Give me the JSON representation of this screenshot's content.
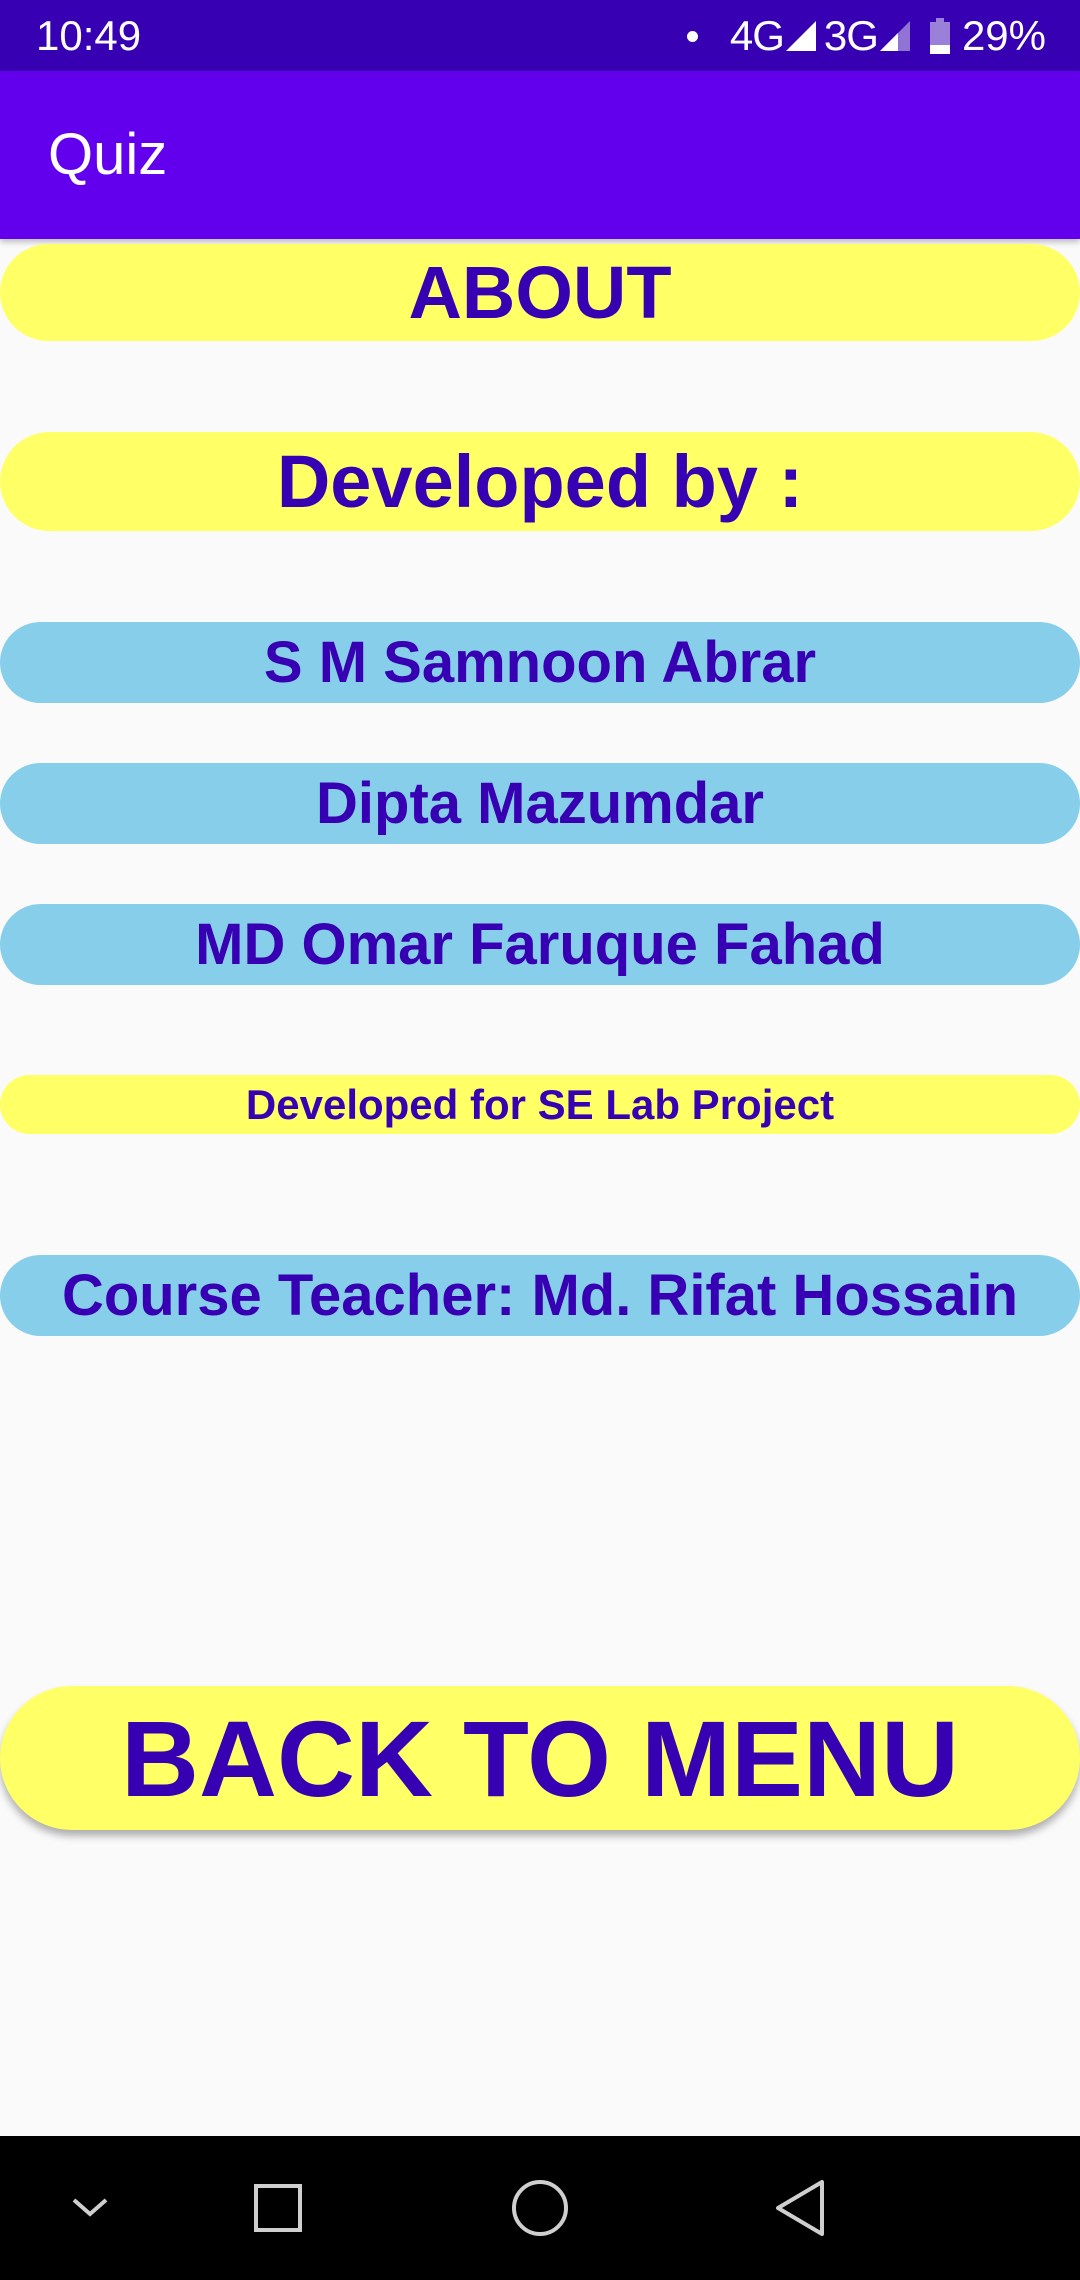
{
  "status_bar": {
    "time": "10:49",
    "network_1": "4G",
    "network_2": "3G",
    "battery": "29%",
    "battery_level": 0.29
  },
  "app_bar": {
    "title": "Quiz",
    "color": "#6200ee"
  },
  "about": {
    "heading": "ABOUT",
    "developed_by_label": "Developed by :",
    "developers": [
      "S M Samnoon Abrar",
      "Dipta Mazumdar",
      "MD Omar Faruque Fahad"
    ],
    "project_note": "Developed for SE Lab Project",
    "course_teacher": "Course Teacher: Md. Rifat Hossain"
  },
  "actions": {
    "back_to_menu": "BACK TO MENU"
  },
  "nav_bar": {
    "icons": [
      "chevron-down-icon",
      "recents-icon",
      "home-icon",
      "back-icon"
    ]
  },
  "colors": {
    "accent_text": "#3700b3",
    "yellow_pill": "#ffff66",
    "blue_pill": "#87ceeb",
    "status_bar": "#3700b3"
  }
}
